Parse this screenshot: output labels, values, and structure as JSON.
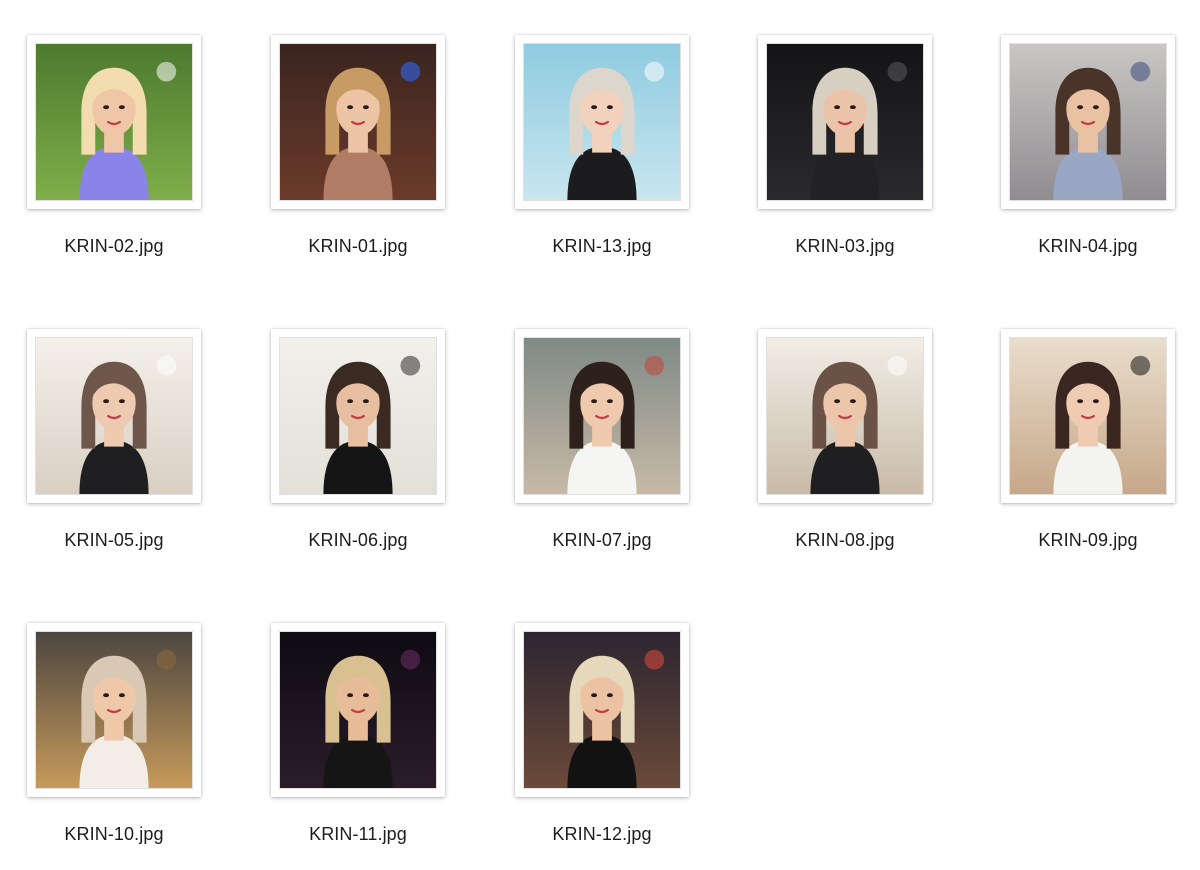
{
  "window": {
    "title": ""
  },
  "files": [
    {
      "name": "KRIN-02.jpg",
      "thumb": {
        "bg_top": "#4d7a2e",
        "bg_bottom": "#7fae4a",
        "hair": "#f3ddb0",
        "skin": "#efc6a6",
        "top": "#8b84e8",
        "accent": "#ffffff"
      }
    },
    {
      "name": "KRIN-01.jpg",
      "thumb": {
        "bg_top": "#3a2420",
        "bg_bottom": "#6b3b2a",
        "hair": "#c89a64",
        "skin": "#edc4a6",
        "top": "#b07c66",
        "accent": "#2f6bff"
      }
    },
    {
      "name": "KRIN-13.jpg",
      "thumb": {
        "bg_top": "#8fcbe0",
        "bg_bottom": "#c8e6ef",
        "hair": "#dcd6cc",
        "skin": "#f2d2bc",
        "top": "#1c1c1e",
        "accent": "#ffffff"
      }
    },
    {
      "name": "KRIN-03.jpg",
      "thumb": {
        "bg_top": "#141416",
        "bg_bottom": "#2a2a2e",
        "hair": "#d7d0c2",
        "skin": "#ebc3a8",
        "top": "#222224",
        "accent": "#5a5a60"
      }
    },
    {
      "name": "KRIN-04.jpg",
      "thumb": {
        "bg_top": "#c9c6c4",
        "bg_bottom": "#8f8d90",
        "hair": "#4a342a",
        "skin": "#e8c2a3",
        "top": "#9aa7c4",
        "accent": "#3a4a7a"
      }
    },
    {
      "name": "KRIN-05.jpg",
      "thumb": {
        "bg_top": "#f4f0ea",
        "bg_bottom": "#d9cfc3",
        "hair": "#6e564a",
        "skin": "#eecab0",
        "top": "#1f1f22",
        "accent": "#ffffff"
      }
    },
    {
      "name": "KRIN-06.jpg",
      "thumb": {
        "bg_top": "#f2f0ea",
        "bg_bottom": "#e3e0d8",
        "hair": "#3b2a22",
        "skin": "#e7bea0",
        "top": "#151515",
        "accent": "#2a2a2a"
      }
    },
    {
      "name": "KRIN-07.jpg",
      "thumb": {
        "bg_top": "#7f8a86",
        "bg_bottom": "#c7b9a6",
        "hair": "#2e201b",
        "skin": "#efc9ae",
        "top": "#f5f5f3",
        "accent": "#c2453a"
      }
    },
    {
      "name": "KRIN-08.jpg",
      "thumb": {
        "bg_top": "#f1ede6",
        "bg_bottom": "#c9bba8",
        "hair": "#6b5246",
        "skin": "#ecc6aa",
        "top": "#1f1f22",
        "accent": "#ffffff"
      }
    },
    {
      "name": "KRIN-09.jpg",
      "thumb": {
        "bg_top": "#e9ddcc",
        "bg_bottom": "#c6a889",
        "hair": "#3a2722",
        "skin": "#efcbb2",
        "top": "#f3f3f0",
        "accent": "#141414"
      }
    },
    {
      "name": "KRIN-10.jpg",
      "thumb": {
        "bg_top": "#4d4640",
        "bg_bottom": "#c69a5a",
        "hair": "#d9c8b4",
        "skin": "#efc8aa",
        "top": "#f2ede6",
        "accent": "#8c6a3c"
      }
    },
    {
      "name": "KRIN-11.jpg",
      "thumb": {
        "bg_top": "#0e0b12",
        "bg_bottom": "#2b1c2a",
        "hair": "#d8c091",
        "skin": "#e7bc98",
        "top": "#151515",
        "accent": "#6f2d6a"
      }
    },
    {
      "name": "KRIN-12.jpg",
      "thumb": {
        "bg_top": "#2c2530",
        "bg_bottom": "#6b4a3a",
        "hair": "#e6d8bb",
        "skin": "#ecc3a2",
        "top": "#121212",
        "accent": "#e24a3a"
      }
    }
  ]
}
